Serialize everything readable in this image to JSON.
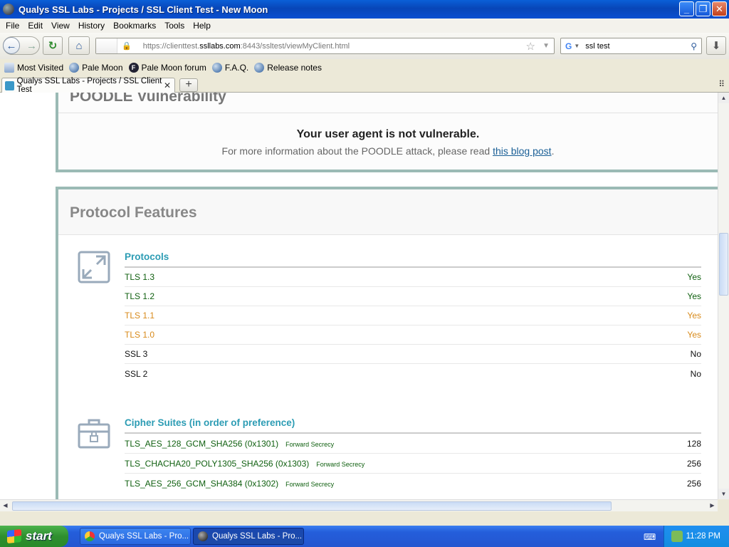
{
  "window": {
    "title": "Qualys SSL Labs - Projects / SSL Client Test - New Moon"
  },
  "menu": [
    "File",
    "Edit",
    "View",
    "History",
    "Bookmarks",
    "Tools",
    "Help"
  ],
  "urlbar": {
    "prefix": "https://clienttest.",
    "domain": "ssllabs.com",
    "suffix": ":8443/ssltest/viewMyClient.html"
  },
  "search": {
    "engine": "G",
    "query": "ssl test"
  },
  "bookmarks": [
    "Most Visited",
    "Pale Moon",
    "Pale Moon forum",
    "F.A.Q.",
    "Release notes"
  ],
  "tab": {
    "label": "Qualys SSL Labs - Projects / SSL Client Test"
  },
  "poodle": {
    "heading": "POODLE Vulnerability",
    "message": "Your user agent is not vulnerable.",
    "info_prefix": "For more information about the POODLE attack, please read ",
    "info_link": "this blog post",
    "info_suffix": "."
  },
  "protocol_features": {
    "heading": "Protocol Features",
    "protocols": {
      "title": "Protocols",
      "rows": [
        {
          "name": "TLS 1.3",
          "value": "Yes",
          "status": "green"
        },
        {
          "name": "TLS 1.2",
          "value": "Yes",
          "status": "green"
        },
        {
          "name": "TLS 1.1",
          "value": "Yes",
          "status": "orange"
        },
        {
          "name": "TLS 1.0",
          "value": "Yes",
          "status": "orange"
        },
        {
          "name": "SSL 3",
          "value": "No",
          "status": "black"
        },
        {
          "name": "SSL 2",
          "value": "No",
          "status": "black"
        }
      ]
    },
    "ciphers": {
      "title": "Cipher Suites (in order of preference)",
      "rows": [
        {
          "name": "TLS_AES_128_GCM_SHA256 (0x1301)",
          "tag": "Forward Secrecy",
          "value": "128"
        },
        {
          "name": "TLS_CHACHA20_POLY1305_SHA256 (0x1303)",
          "tag": "Forward Secrecy",
          "value": "256"
        },
        {
          "name": "TLS_AES_256_GCM_SHA384 (0x1302)",
          "tag": "Forward Secrecy",
          "value": "256"
        }
      ]
    }
  },
  "taskbar": {
    "start": "start",
    "buttons": [
      "Qualys SSL Labs - Pro...",
      "Qualys SSL Labs - Pro..."
    ],
    "clock": "11:28 PM"
  },
  "colors": {
    "accent": "#2c9cb4",
    "green": "#106010",
    "orange": "#d88a1a",
    "card_border": "#9bbab5"
  }
}
